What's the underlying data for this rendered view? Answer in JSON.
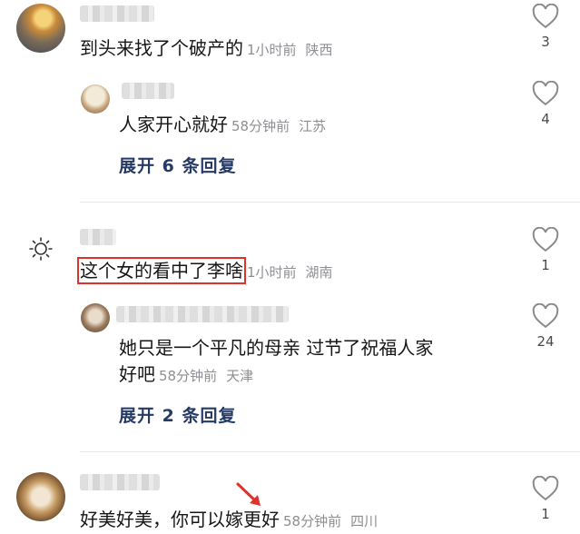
{
  "colors": {
    "accent_red": "#e0312b",
    "expand_blue": "#253a64",
    "meta_grey": "#8e8e93"
  },
  "comments": [
    {
      "text": "到头来找了个破产的",
      "time": "1小时前",
      "location": "陕西",
      "likes": "3",
      "reply": {
        "text": "人家开心就好",
        "time": "58分钟前",
        "location": "江苏",
        "likes": "4"
      },
      "expand_label": "展开 6 条回复"
    },
    {
      "text": "这个女的看中了李啥",
      "time": "1小时前",
      "location": "湖南",
      "likes": "1",
      "reply": {
        "text_line1": "她只是一个平凡的母亲 过节了祝福人家",
        "text_line2": "好吧",
        "time": "58分钟前",
        "location": "天津",
        "likes": "24"
      },
      "expand_label": "展开 2 条回复"
    },
    {
      "text": "好美好美，你可以嫁更好",
      "time": "58分钟前",
      "location": "四川",
      "likes": "1"
    }
  ]
}
